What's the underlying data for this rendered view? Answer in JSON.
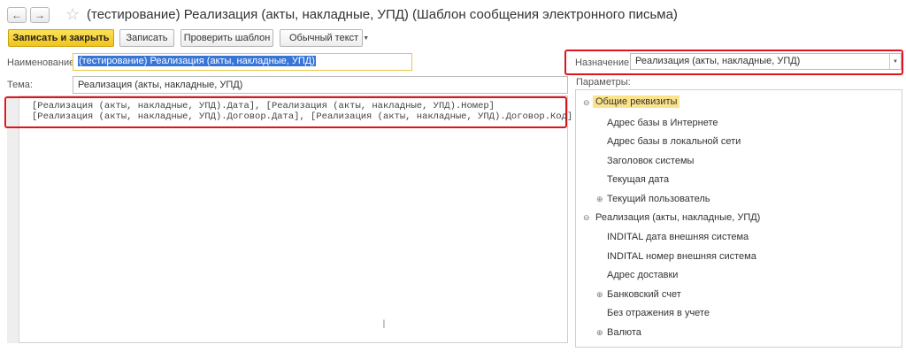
{
  "window": {
    "back_icon": "arrow-left-icon",
    "forward_icon": "arrow-right-icon",
    "favorite_icon": "star-icon",
    "title": "(тестирование) Реализация (акты, накладные, УПД) (Шаблон сообщения электронного письма)"
  },
  "toolbar": {
    "save_close": "Записать и закрыть",
    "save": "Записать",
    "check": "Проверить шаблон",
    "format": "Обычный текст"
  },
  "form": {
    "name_label": "Наименование:",
    "name_value": "(тестирование) Реализация (акты, накладные, УПД)",
    "purpose_label": "Назначение:",
    "purpose_value": "Реализация (акты, накладные, УПД)",
    "subject_label": "Тема:",
    "subject_value": "Реализация (акты, накладные, УПД)",
    "params_label": "Параметры:"
  },
  "body_text": {
    "line1": "[Реализация (акты, накладные, УПД).Дата], [Реализация (акты, накладные, УПД).Номер]",
    "line2": "[Реализация (акты, накладные, УПД).Договор.Дата], [Реализация (акты, накладные, УПД).Договор.Код]"
  },
  "tree": {
    "group1": "Общие реквизиты",
    "g1_items": [
      "Адрес базы в Интернете",
      "Адрес базы в локальной сети",
      "Заголовок системы",
      "Текущая дата",
      "Текущий пользователь"
    ],
    "group2": "Реализация (акты, накладные, УПД)",
    "g2_items": [
      "INDITAL дата внешняя система",
      "INDITAL номер внешняя система",
      "Адрес доставки",
      "Банковский счет",
      "Без отражения в учете",
      "Валюта"
    ]
  },
  "colors": {
    "accent": "#f2c419",
    "highlight_red": "#e0141c",
    "selection": "#3875d7"
  }
}
